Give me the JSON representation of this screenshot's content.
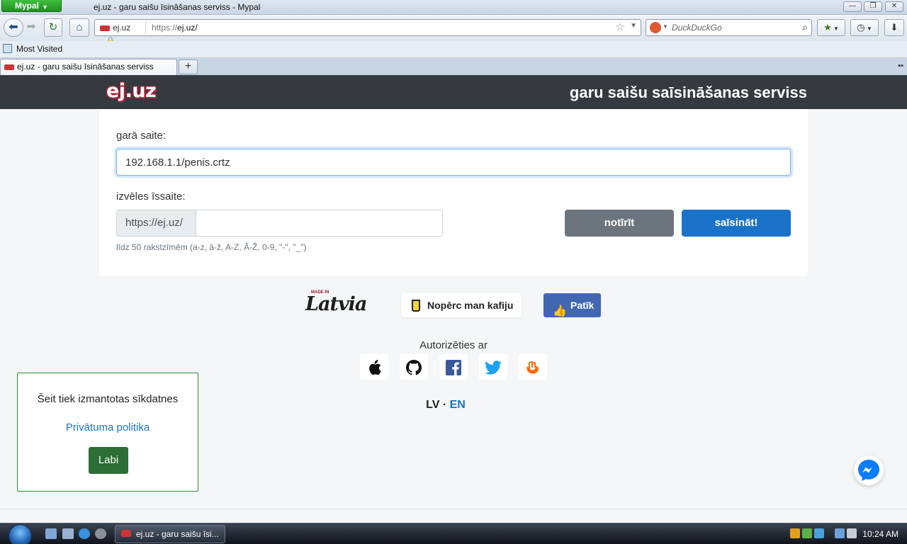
{
  "browser": {
    "app_menu": "Mypal",
    "window_title": "ej.uz - garu saišu īsināšanas serviss - Mypal",
    "identity_label": "ej.uz",
    "url_scheme": "https://",
    "url_host": "ej.uz/",
    "search_placeholder": "DuckDuckGo",
    "bookmarks": [
      "Most Visited"
    ],
    "tabs": [
      {
        "title": "ej.uz - garu saišu īsināšanas serviss"
      }
    ],
    "new_tab": "+"
  },
  "site": {
    "logo": "ej.uz",
    "tagline": "garu saišu saīsināšanas serviss"
  },
  "form": {
    "long_link_label": "garā saite:",
    "long_link_value": "192.168.1.1/penis.crtz",
    "short_link_label": "izvēles īssaite:",
    "prefix": "https://ej.uz/",
    "slug_value": "",
    "hint": "līdz 50 rakstzīmēm (a-z, ā-ž, A-Z, Ā-Ž, 0-9, \"-\", \"_\")",
    "clear_button": "notīrīt",
    "shorten_button": "saīsināt!"
  },
  "badges": {
    "made_in": "MADE IN",
    "latvia": "Latvia",
    "coffee": "Nopērc man kafiju",
    "like": "Patīk"
  },
  "auth": {
    "label": "Autorizēties ar",
    "providers": [
      "apple-icon",
      "github-icon",
      "facebook-icon",
      "twitter-icon",
      "draugiem-icon"
    ]
  },
  "language": {
    "lv": "LV",
    "sep": " · ",
    "en": "EN"
  },
  "cookie": {
    "message": "Šeit tiek izmantotas sīkdatnes",
    "privacy": "Privātuma politika",
    "ok": "Labi"
  },
  "taskbar": {
    "item": "ej.uz - garu saišu īsi...",
    "clock": "10:24 AM"
  },
  "colors": {
    "header_bg": "#343a40",
    "primary": "#1a73c9",
    "secondary": "#6c757d",
    "cookie_ok": "#2c6e35",
    "logo_red": "#b3203a"
  }
}
